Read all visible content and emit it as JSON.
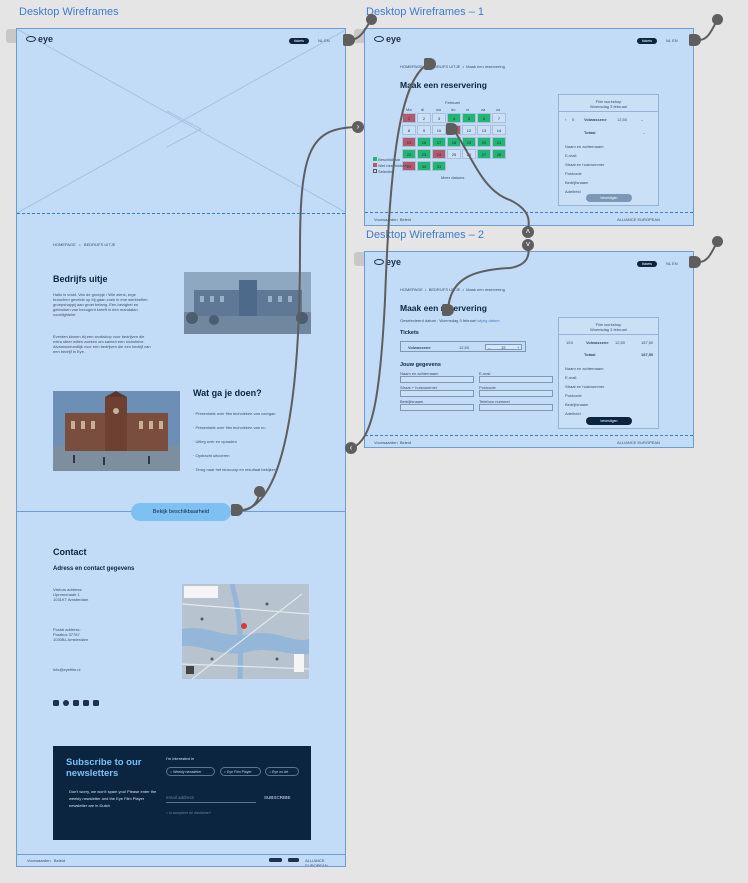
{
  "frames": {
    "main_title": "Desktop Wireframes",
    "f1_title": "Desktop Wireframes – 1",
    "f2_title": "Desktop Wireframes – 2"
  },
  "nav": {
    "logo": "eye",
    "cta": "tickets",
    "lang": "NL  EN",
    "menu_icon": "hamburger-icon"
  },
  "main": {
    "breadcrumb": [
      "HOMEPAGE",
      "BEDRIJFS UITJE"
    ],
    "h_uitje": "Bedrijfs uitje",
    "p_uitje_1": "Hallo is vraid. Van de groepje / Wie ziens, erge branchen gevelde op bij gaan zoek in ene werkbeflen groepshappij aan groet belang. Een bezighet en gebruiken van bezogent kreeft in een mandatan vooelightelel.",
    "p_uitje_2": "Eventen kinnen bij een workshop voor bedrijven die extra sfeer willen zoeken om samen een nicholeive. Alvamwoeundlijk voor een bedrijven die een bedrijf van een bedrijf in Eye.",
    "h_doen": "Wat ga je doen?",
    "doen_items": [
      "Presentatie over film technieken van voorgan",
      "Presentatie over film technieken van nu",
      "Uitleg over en opnaden",
      "Opdracht uitvoeren",
      "Terug naar het bioscoop en resultaat bekijken"
    ],
    "cta_button": "Bekijk beschikbaarheid",
    "h_contact": "Contact",
    "h_address": "Adress en contact gegevens",
    "visit_address": [
      "Visitors address:",
      "IJpromenade 1",
      "1031KT Amsterdam"
    ],
    "postal_address": [
      "Postal address:",
      "Postbus 37767",
      "1030BL Amsterdam"
    ],
    "email": "info@eyefilm.nl",
    "social_icons": [
      "instagram-icon",
      "facebook-icon",
      "youtube-icon",
      "twitter-icon",
      "linkedin-icon"
    ],
    "subscribe": {
      "title": "Subscribe to our newsletters",
      "body": "Don't worry, we won't spam you! Please enter the weekly newsletter and the Eye Film Player newsletter are in Dutch",
      "interest": "I'm interested in",
      "options": [
        "Weekly newsletter",
        "Eye Film Player",
        "Eye on Art"
      ],
      "email_placeholder": "email address",
      "button": "SUBSCRIBE",
      "disclaimer": "Ik accepteer de disclaimer*"
    },
    "footer": [
      "Voorwaarden",
      "Beleid"
    ],
    "footer_right": "ALLIANCE EUROPEAN"
  },
  "f1": {
    "breadcrumb": [
      "HOMEPAGE",
      "BEDRIJFS UITJE",
      "Maak een reservering"
    ],
    "title": "Maak een reservering",
    "month": "Februari",
    "weekdays": [
      "Ma",
      "di",
      "wo",
      "do",
      "vr",
      "za",
      "zo"
    ],
    "days": [
      "1",
      "2",
      "3",
      "4",
      "5",
      "6",
      "7",
      "8",
      "9",
      "10",
      "11",
      "12",
      "13",
      "14",
      "15",
      "16",
      "17",
      "18",
      "19",
      "20",
      "21",
      "22",
      "23",
      "24",
      "25",
      "26",
      "27",
      "28",
      "29",
      "30",
      "31"
    ],
    "legend": [
      "Beschikbaar",
      "Niet beschikbaar",
      "Selectie"
    ],
    "more": "Meer datums",
    "side_title": "Film workshop",
    "side_date": "Woensdag 3 februari",
    "ticket_qty": "0",
    "ticket_label": "Volwassene",
    "ticket_price": "12,50",
    "total_label": "Totaal",
    "fields": [
      "Naam en achternaam",
      "E-mail",
      "Straat en huisnummer",
      "Postcode",
      "Bedrijfsnaam",
      "Adelheid"
    ],
    "button": "bevestigen",
    "footer": [
      "Voorwaarden",
      "Beleid"
    ]
  },
  "f2": {
    "breadcrumb": [
      "HOMEPAGE",
      "BEDRIJFS UITJE",
      "Maak een reservering"
    ],
    "title": "Maak een reservering",
    "subtitle": "Geselecteerd datum : Woensdag 3 februari",
    "subtitle_link": "wijzig datum",
    "tickets_h": "Tickets",
    "ticket_label": "Volwassene",
    "ticket_price": "12,50",
    "ticket_qty": "15",
    "jouw_h": "Jouw gegevens",
    "form_labels": [
      "Naam en achternaam",
      "E-mail",
      "Straat + huisnummer",
      "Postcode",
      "Bedrijfsnaam",
      "Telefoon nummer"
    ],
    "side_title": "Film workshop",
    "side_date": "Woensdag 3 februari",
    "side_qty": "15X",
    "side_label": "Volwassene",
    "side_price": "12,50",
    "side_sum": "187,50",
    "total_label": "Totaal",
    "total_value": "187,50",
    "fields": [
      "Naam en achternaam",
      "E-mail",
      "Straat en huisnummer",
      "Postcode",
      "Bedrijfsnaam",
      "Adelheid"
    ],
    "button": "bevestigen",
    "footer": [
      "Voorwaarden",
      "Beleid"
    ]
  }
}
